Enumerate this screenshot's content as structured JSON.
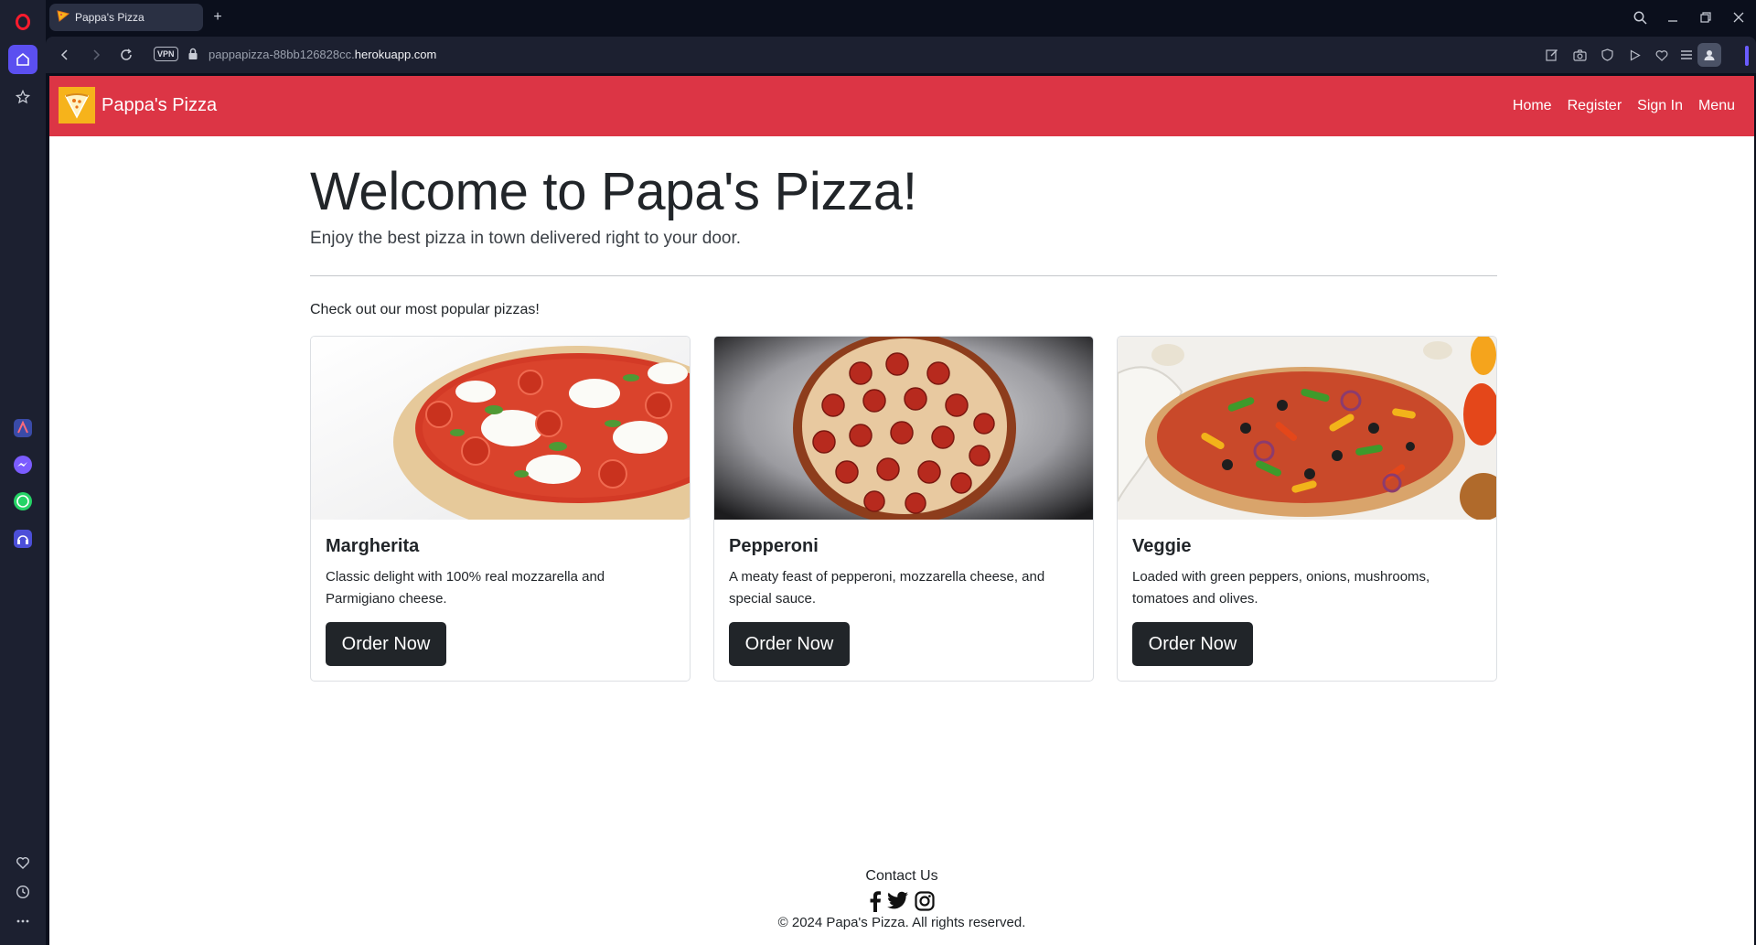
{
  "browser": {
    "tab_title": "Pappa's Pizza",
    "new_tab_label": "+",
    "vpn_label": "VPN",
    "url_prefix": "pappapizza-88bb126828cc.",
    "url_host": "herokuapp.com"
  },
  "site": {
    "brand_name": "Pappa's Pizza",
    "nav": [
      "Home",
      "Register",
      "Sign In",
      "Menu"
    ],
    "hero_title": "Welcome to Papa's Pizza!",
    "hero_subtitle": "Enjoy the best pizza in town delivered right to your door.",
    "popular_heading": "Check out our most popular pizzas!",
    "pizzas": [
      {
        "name": "Margherita",
        "description": "Classic delight with 100% real mozzarella and Parmigiano cheese.",
        "button": "Order Now"
      },
      {
        "name": "Pepperoni",
        "description": "A meaty feast of pepperoni, mozzarella cheese, and special sauce.",
        "button": "Order Now"
      },
      {
        "name": "Veggie",
        "description": "Loaded with green peppers, onions, mushrooms, tomatoes and olives.",
        "button": "Order Now"
      }
    ],
    "footer": {
      "contact_label": "Contact Us",
      "social_icons": [
        "facebook-icon",
        "twitter-icon",
        "instagram-icon"
      ],
      "copyright": "© 2024 Papa's Pizza. All rights reserved."
    }
  },
  "colors": {
    "navbar": "#dc3545",
    "button": "#212529",
    "logo": "#f6b31b",
    "browser_frame": "#0b0f1c",
    "sidebar": "#1c2030"
  }
}
